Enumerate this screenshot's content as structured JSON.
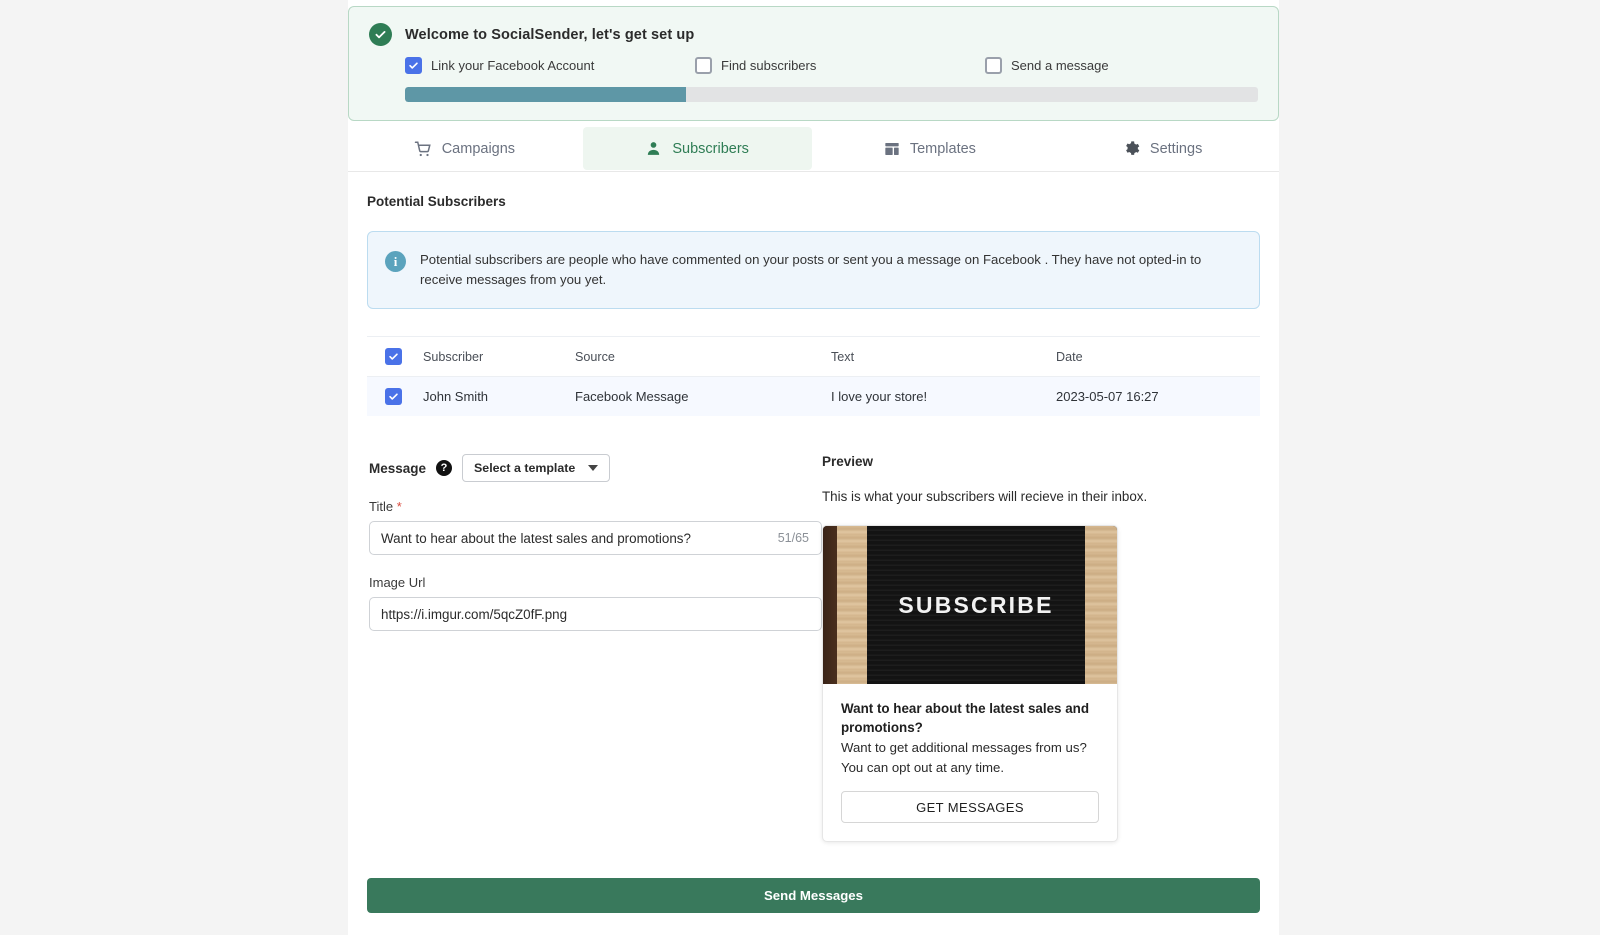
{
  "onboarding": {
    "title": "Welcome to SocialSender, let's get set up",
    "status_icon": "check-circle-icon",
    "progress_percent": 33,
    "steps": [
      {
        "label": "Link your Facebook Account",
        "checked": true
      },
      {
        "label": "Find subscribers",
        "checked": false
      },
      {
        "label": "Send a message",
        "checked": false
      }
    ]
  },
  "tabs": [
    {
      "label": "Campaigns",
      "icon": "cart-icon",
      "active": false
    },
    {
      "label": "Subscribers",
      "icon": "person-icon",
      "active": true
    },
    {
      "label": "Templates",
      "icon": "layout-icon",
      "active": false
    },
    {
      "label": "Settings",
      "icon": "gear-icon",
      "active": false
    }
  ],
  "main": {
    "section_title": "Potential Subscribers",
    "info_icon": "info-icon",
    "info_text": "Potential subscribers are people who have commented on your posts or sent you a message on Facebook . They have not opted-in to receive messages from you yet."
  },
  "table": {
    "select_all_checked": true,
    "columns": [
      "Subscriber",
      "Source",
      "Text",
      "Date"
    ],
    "rows": [
      {
        "checked": true,
        "subscriber": "John Smith",
        "source": "Facebook Message",
        "text": "I love your store!",
        "date": "2023-05-07 16:27"
      }
    ]
  },
  "form": {
    "message_label": "Message",
    "help_icon": "help-icon",
    "template_select_value": "Select a template",
    "title_label": "Title",
    "title_required_marker": "*",
    "title_value": "Want to hear about the latest sales and promotions?",
    "title_counter": "51/65",
    "image_url_label": "Image Url",
    "image_url_value": "https://i.imgur.com/5qcZ0fF.png"
  },
  "preview": {
    "heading": "Preview",
    "subtext": "This is what your subscribers will recieve in their inbox.",
    "image_alt_text": "SUBSCRIBE",
    "card_title": "Want to hear about the latest sales and promotions?",
    "card_body": "Want to get additional messages from us? You can opt out at any time.",
    "card_button": "GET MESSAGES"
  },
  "footer": {
    "send_label": "Send Messages"
  },
  "colors": {
    "brand_green": "#39795c",
    "accent_teal": "#5e97a6",
    "checkbox_blue": "#4a72e8",
    "info_blue_bg": "#eff6fc",
    "banner_green_bg": "#f1f8f4",
    "required_red": "#d94a3d"
  }
}
